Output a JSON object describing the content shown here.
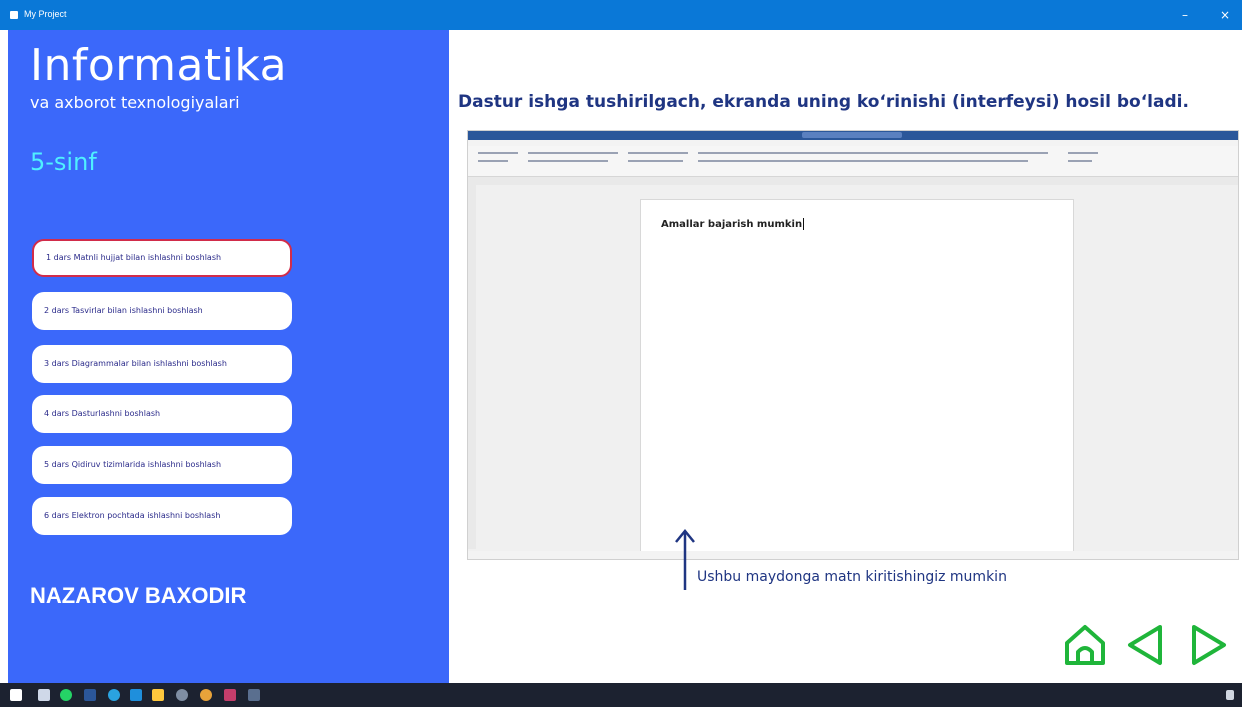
{
  "window": {
    "title": "My Project"
  },
  "sidebar": {
    "brand": "Informatika",
    "brand_sub": "va axborot texnologiyalari",
    "grade": "5-sinf",
    "lessons": [
      {
        "label": "1 dars Matnli hujjat bilan ishlashni boshlash",
        "active": true
      },
      {
        "label": "2 dars Tasvirlar bilan ishlashni boshlash",
        "active": false
      },
      {
        "label": "3 dars Diagrammalar bilan ishlashni boshlash",
        "active": false
      },
      {
        "label": "4 dars Dasturlashni boshlash",
        "active": false
      },
      {
        "label": "5 dars Qidiruv tizimlarida ishlashni boshlash",
        "active": false
      },
      {
        "label": "6 dars Elektron pochtada ishlashni boshlash",
        "active": false
      }
    ],
    "author": "NAZAROV BAXODIR"
  },
  "main": {
    "headline": "Dastur ishga tushirilgach, ekranda uning ko‘rinishi (interfeysi) hosil bo‘ladi.",
    "document_text": "Amallar bajarish mumkin",
    "hint": "Ushbu maydonga matn kiritishingiz mumkin"
  },
  "nav": {
    "home_icon": "home-icon",
    "back_icon": "triangle-left-icon",
    "forward_icon": "triangle-right-icon",
    "color": "#1fb53a"
  },
  "colors": {
    "sidebar_bg": "#3b68fa",
    "grade": "#4ff0ff",
    "title_bar": "#0a78d7",
    "active_border": "#d12c4a",
    "text_dark": "#1f3582"
  }
}
